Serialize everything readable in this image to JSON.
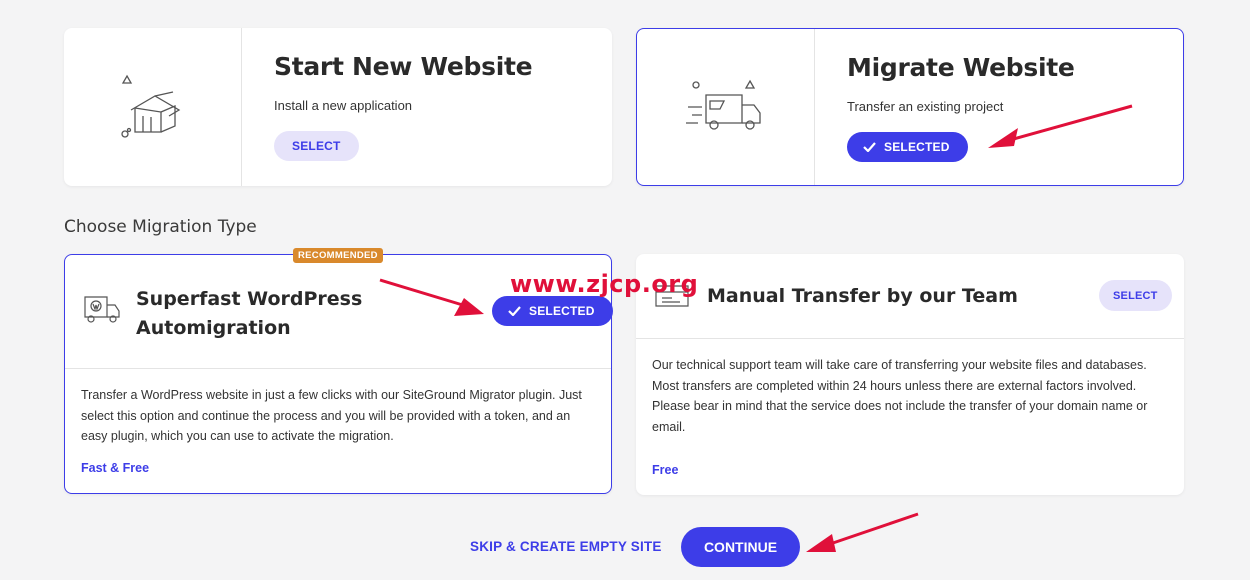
{
  "start_card": {
    "title": "Start New Website",
    "subtitle": "Install a new application",
    "button": "SELECT",
    "icon": "house-icon"
  },
  "migrate_card": {
    "title": "Migrate Website",
    "subtitle": "Transfer an existing project",
    "button": "SELECTED",
    "icon": "moving-truck-icon"
  },
  "section_title": "Choose Migration Type",
  "auto_card": {
    "badge": "RECOMMENDED",
    "title": "Superfast WordPress Automigration",
    "button": "SELECTED",
    "description": "Transfer a WordPress website in just a few clicks with our SiteGround Migrator plugin. Just select this option and continue the process and you will be provided with a token, and an easy plugin, which you can use to activate the migration.",
    "price": "Fast & Free",
    "icon": "wordpress-truck-icon"
  },
  "manual_card": {
    "title": "Manual Transfer by our Team",
    "button": "SELECT",
    "description": "Our technical support team will take care of transferring your website files and databases. Most transfers are completed within 24 hours unless there are external factors involved. Please bear in mind that the service does not include the transfer of your domain name or email.",
    "price": "Free",
    "icon": "support-transfer-icon"
  },
  "footer": {
    "skip": "SKIP & CREATE EMPTY SITE",
    "continue": "CONTINUE"
  },
  "watermark": "www.zjcp.org",
  "colors": {
    "accent": "#3d3de8",
    "accent_light": "#e6e3fa",
    "badge": "#d9892c",
    "annotation_red": "#e0103a"
  }
}
